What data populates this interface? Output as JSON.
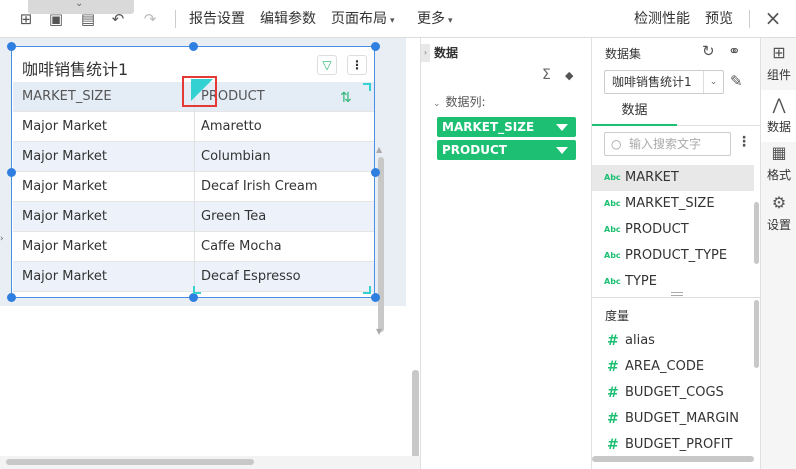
{
  "toolbar": {
    "menus": [
      "报告设置",
      "编辑参数",
      "页面布局",
      "更多"
    ],
    "detect": "检测性能",
    "preview": "预览"
  },
  "widget": {
    "title": "咖啡销售统计1",
    "columns": [
      "MARKET_SIZE",
      "PRODUCT"
    ],
    "rows": [
      [
        "Major Market",
        "Amaretto"
      ],
      [
        "Major Market",
        "Columbian"
      ],
      [
        "Major Market",
        "Decaf Irish Cream"
      ],
      [
        "Major Market",
        "Green Tea"
      ],
      [
        "Major Market",
        "Caffe Mocha"
      ],
      [
        "Major Market",
        "Decaf Espresso"
      ]
    ]
  },
  "data_panel": {
    "title": "数据",
    "section": "数据列:",
    "columns": [
      "MARKET_SIZE",
      "PRODUCT"
    ]
  },
  "dataset_panel": {
    "title": "数据集",
    "selected": "咖啡销售统计1",
    "tab": "数据",
    "search_placeholder": "输入搜索文字",
    "dimensions": [
      "MARKET",
      "MARKET_SIZE",
      "PRODUCT",
      "PRODUCT_TYPE",
      "TYPE"
    ],
    "measure_label": "度量",
    "measures": [
      "alias",
      "AREA_CODE",
      "BUDGET_COGS",
      "BUDGET_MARGIN",
      "BUDGET_PROFIT"
    ]
  },
  "side_tabs": [
    "组件",
    "数据",
    "格式",
    "设置"
  ],
  "colors": {
    "accent": "#1dbf73",
    "selection": "#2f7fe0",
    "highlight": "#e53935",
    "cyan": "#33d1d1"
  }
}
